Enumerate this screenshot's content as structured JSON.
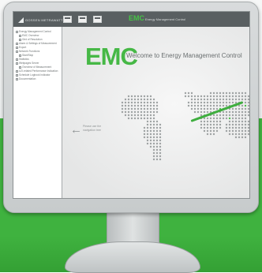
{
  "topbar": {
    "logo_text": "GOSSEN METRAWATT",
    "app_title": "EMC",
    "app_subtitle": "Energy Management Control",
    "icons": [
      "monitor-icon",
      "chart-icon",
      "settings-icon"
    ]
  },
  "sidebar": {
    "items": [
      {
        "label": "Energy Management Control",
        "indent": 0
      },
      {
        "label": "EMC Overview",
        "indent": 1
      },
      {
        "label": "Grid of Resolution",
        "indent": 1
      },
      {
        "label": "Alarm & Settings of Measurement",
        "indent": 0
      },
      {
        "label": "Export",
        "indent": 0
      },
      {
        "label": "Network Functions",
        "indent": 0
      },
      {
        "label": "Start/Stop",
        "indent": 1
      },
      {
        "label": "Statistics",
        "indent": 0
      },
      {
        "label": "Webpages Server",
        "indent": 0
      },
      {
        "label": "Overview of Measurement",
        "indent": 1
      },
      {
        "label": "U2I-related Performance Indication",
        "indent": 0
      },
      {
        "label": "Schedule Logbook Indicator",
        "indent": 0
      },
      {
        "label": "Documentation",
        "indent": 0
      }
    ]
  },
  "main": {
    "logo_text": "EMC",
    "welcome_text": "Welcome to Energy Management Control",
    "back_hint": "Please use the navigation tree"
  },
  "colors": {
    "accent_green": "#46b846",
    "topbar_gray": "#595f61",
    "background_green": "#3fb23f"
  }
}
